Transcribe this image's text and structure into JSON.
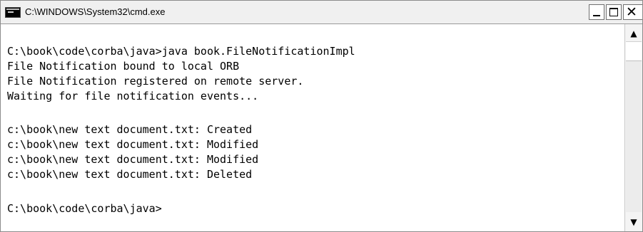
{
  "window": {
    "title": "C:\\WINDOWS\\System32\\cmd.exe",
    "icon": "console-icon",
    "controls": {
      "minimize": "minimize-icon",
      "maximize": "maximize-icon",
      "close": "close-icon",
      "close_glyph": "✕"
    }
  },
  "console": {
    "lines": [
      "C:\\book\\code\\corba\\java>java book.FileNotificationImpl",
      "File Notification bound to local ORB",
      "File Notification registered on remote server.",
      "Waiting for file notification events...",
      "",
      "c:\\book\\new text document.txt: Created",
      "c:\\book\\new text document.txt: Modified",
      "c:\\book\\new text document.txt: Modified",
      "c:\\book\\new text document.txt: Deleted",
      "",
      "C:\\book\\code\\corba\\java>"
    ]
  },
  "scrollbar": {
    "up_arrow": "▲",
    "down_arrow": "▼"
  },
  "colors": {
    "console_background": "#ffffff",
    "console_text": "#000000",
    "titlebar_background": "#f0f0f0"
  }
}
